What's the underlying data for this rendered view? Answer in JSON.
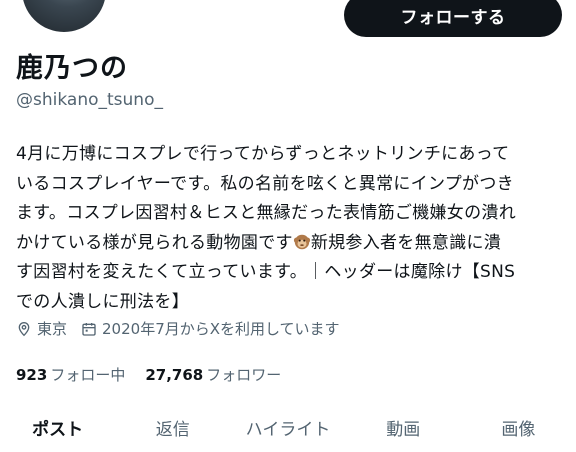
{
  "profile": {
    "display_name": "鹿乃つの",
    "handle": "@shikano_tsuno_",
    "follow_label": "フォローする",
    "bio_lines": [
      "4月に万博にコスプレで行ってからずっとネットリンチにあって",
      "いるコスプレイヤーです。私の名前を呟くと異常にインプがつき",
      "ます。コスプレ因習村＆ヒスと無縁だった表情筋ご機嫌女の潰れ",
      "かけている様が見られる動物園です",
      "新規参入者を無意識に潰",
      "す因習村を変えたくて立っています。｜ヘッダーは魔除け【SNS",
      "での人潰しに刑法を】"
    ],
    "bio_emoji": "monkey-emoji",
    "location": "東京",
    "joined": "2020年7月からXを利用しています",
    "following_count": "923",
    "following_label": "フォロー中",
    "followers_count": "27,768",
    "followers_label": "フォロワー"
  },
  "tabs": [
    "ポスト",
    "返信",
    "ハイライト",
    "動画",
    "画像"
  ],
  "colors": {
    "text": "#0f1419",
    "secondary": "#536471",
    "button_bg": "#0f1419"
  }
}
